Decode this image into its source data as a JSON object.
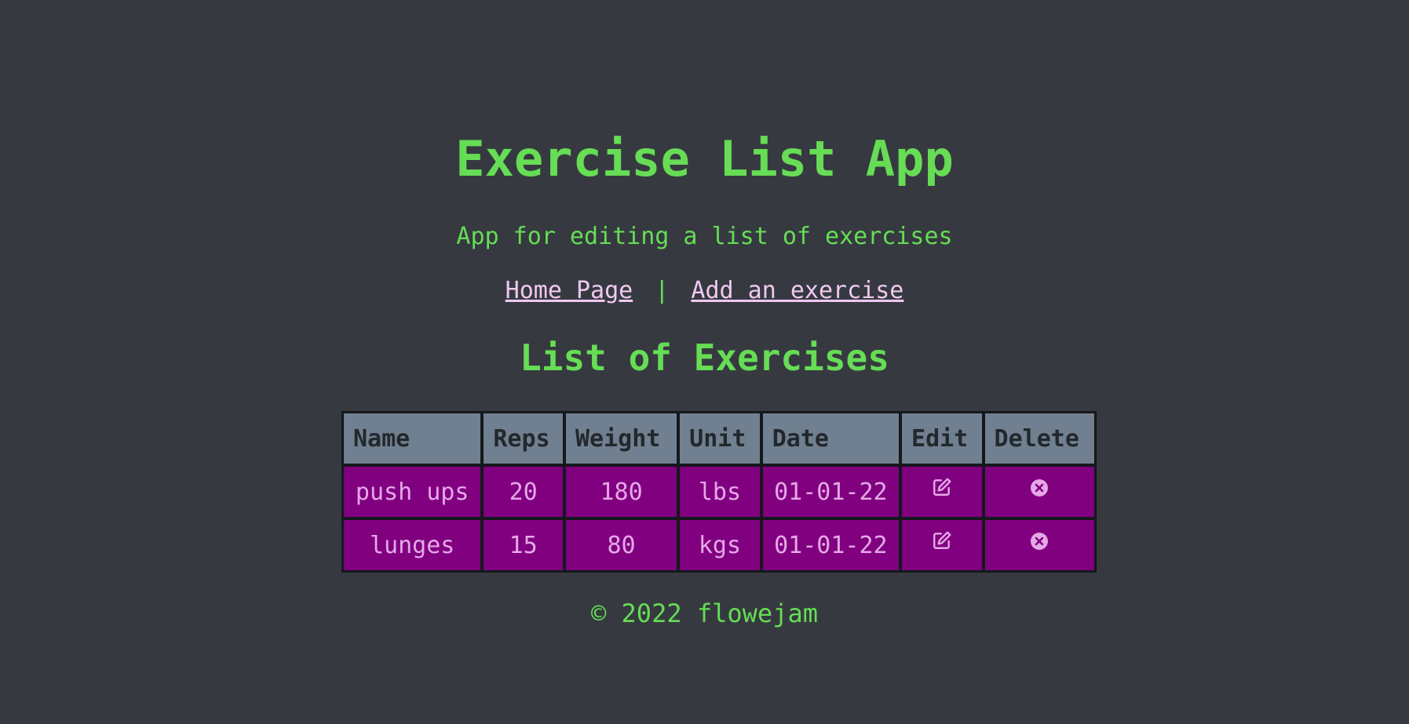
{
  "header": {
    "title": "Exercise List App",
    "subtitle": "App for editing a list of exercises"
  },
  "nav": {
    "home_label": "Home Page",
    "separator": "|",
    "add_label": "Add an exercise"
  },
  "main": {
    "heading": "List of Exercises",
    "table": {
      "columns": [
        "Name",
        "Reps",
        "Weight",
        "Unit",
        "Date",
        "Edit",
        "Delete"
      ],
      "rows": [
        {
          "name": "push ups",
          "reps": "20",
          "weight": "180",
          "unit": "lbs",
          "date": "01-01-22",
          "edit_icon": "edit-icon",
          "delete_icon": "delete-circle-icon"
        },
        {
          "name": "lunges",
          "reps": "15",
          "weight": "80",
          "unit": "kgs",
          "date": "01-01-22",
          "edit_icon": "edit-icon",
          "delete_icon": "delete-circle-icon"
        }
      ]
    }
  },
  "footer": {
    "copyright": "© 2022 flowejam"
  },
  "colors": {
    "background": "#363a40",
    "accent_green": "#66dd55",
    "link_pink": "#f0c8f0",
    "header_cell": "#708090",
    "row_cell": "#800080",
    "row_text": "#e6a8e6"
  }
}
